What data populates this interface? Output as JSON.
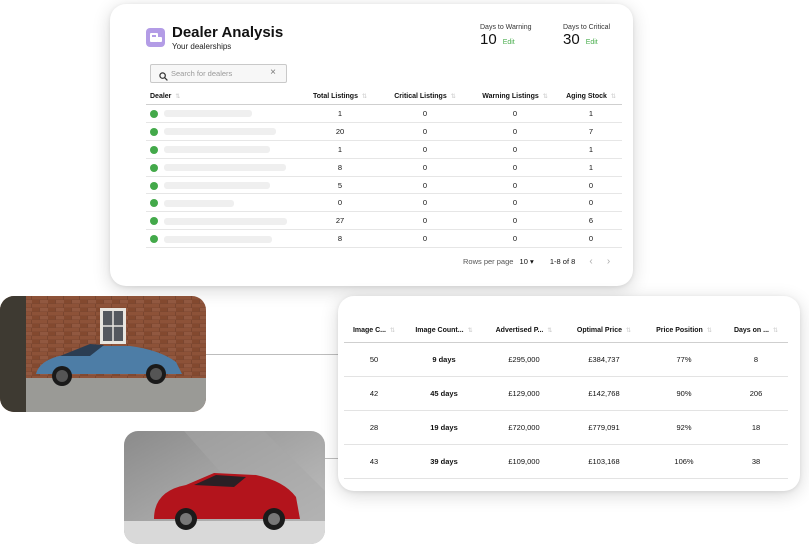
{
  "dealer_card": {
    "title": "Dealer Analysis",
    "subtitle": "Your dealerships",
    "days_to_warning": {
      "label": "Days to Warning",
      "value": "10",
      "edit": "Edit"
    },
    "days_to_critical": {
      "label": "Days to Critical",
      "value": "30",
      "edit": "Edit"
    },
    "search": {
      "placeholder": "Search for dealers"
    },
    "columns": [
      "Dealer",
      "Total Listings",
      "Critical Listings",
      "Warning Listings",
      "Aging Stock"
    ],
    "rows": [
      {
        "total": "1",
        "critical": "0",
        "warning": "0",
        "aging": "1"
      },
      {
        "total": "20",
        "critical": "0",
        "warning": "0",
        "aging": "7"
      },
      {
        "total": "1",
        "critical": "0",
        "warning": "0",
        "aging": "1"
      },
      {
        "total": "8",
        "critical": "0",
        "warning": "0",
        "aging": "1"
      },
      {
        "total": "5",
        "critical": "0",
        "warning": "0",
        "aging": "0"
      },
      {
        "total": "0",
        "critical": "0",
        "warning": "0",
        "aging": "0"
      },
      {
        "total": "27",
        "critical": "0",
        "warning": "0",
        "aging": "6"
      },
      {
        "total": "8",
        "critical": "0",
        "warning": "0",
        "aging": "0"
      }
    ],
    "pagination": {
      "rows_per_page_label": "Rows per page",
      "rows_per_page": "10",
      "range": "1-8 of 8"
    }
  },
  "listings_card": {
    "columns": [
      "Image C...",
      "Image Count...",
      "Advertised P...",
      "Optimal Price",
      "Price Position",
      "Days on ..."
    ],
    "rows": [
      {
        "image_c": "50",
        "image_count": "9 days",
        "advertised": "£295,000",
        "optimal": "£384,737",
        "position": "77%",
        "days": "8"
      },
      {
        "image_c": "42",
        "image_count": "45 days",
        "advertised": "£129,000",
        "optimal": "£142,768",
        "position": "90%",
        "days": "206"
      },
      {
        "image_c": "28",
        "image_count": "19 days",
        "advertised": "£720,000",
        "optimal": "£779,091",
        "position": "92%",
        "days": "18"
      },
      {
        "image_c": "43",
        "image_count": "39 days",
        "advertised": "£109,000",
        "optimal": "£103,168",
        "position": "106%",
        "days": "38"
      }
    ]
  },
  "colors": {
    "accent": "#b39ce6",
    "green": "#43a94a",
    "orange": "#f0a020",
    "red": "#d82020"
  }
}
